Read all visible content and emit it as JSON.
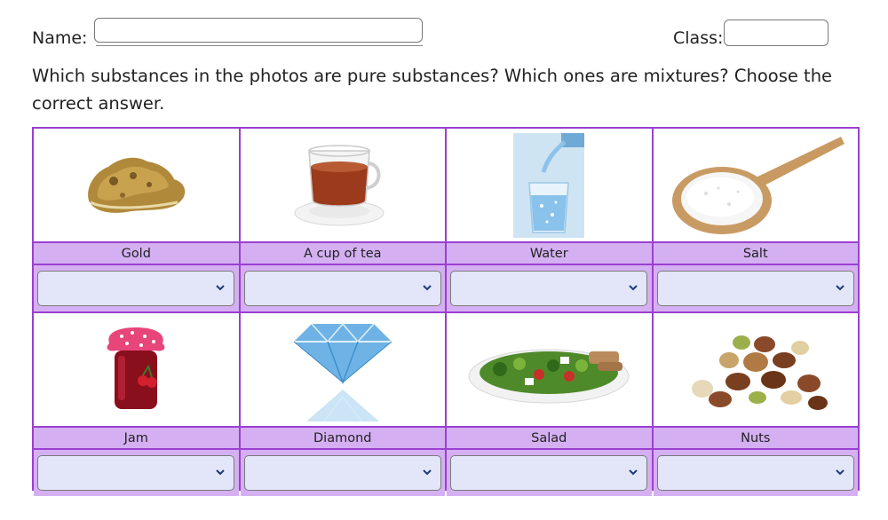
{
  "header": {
    "name_label": "Name:",
    "name_value": "",
    "class_label": "Class:",
    "class_value": ""
  },
  "instructions": "Which substances in the photos are pure substances? Which ones are mixtures? Choose the correct answer.",
  "items": [
    {
      "label": "Gold",
      "image": "gold-nugget-icon",
      "selected": ""
    },
    {
      "label": "A cup of tea",
      "image": "tea-cup-icon",
      "selected": ""
    },
    {
      "label": "Water",
      "image": "water-glass-icon",
      "selected": ""
    },
    {
      "label": "Salt",
      "image": "salt-spoon-icon",
      "selected": ""
    },
    {
      "label": "Jam",
      "image": "jam-jar-icon",
      "selected": ""
    },
    {
      "label": "Diamond",
      "image": "diamond-icon",
      "selected": ""
    },
    {
      "label": "Salad",
      "image": "salad-plate-icon",
      "selected": ""
    },
    {
      "label": "Nuts",
      "image": "nuts-pile-icon",
      "selected": ""
    }
  ],
  "colors": {
    "grid_border": "#9b3fd0",
    "label_bg": "#d4b0f2",
    "select_bg": "#e3e6f8"
  }
}
